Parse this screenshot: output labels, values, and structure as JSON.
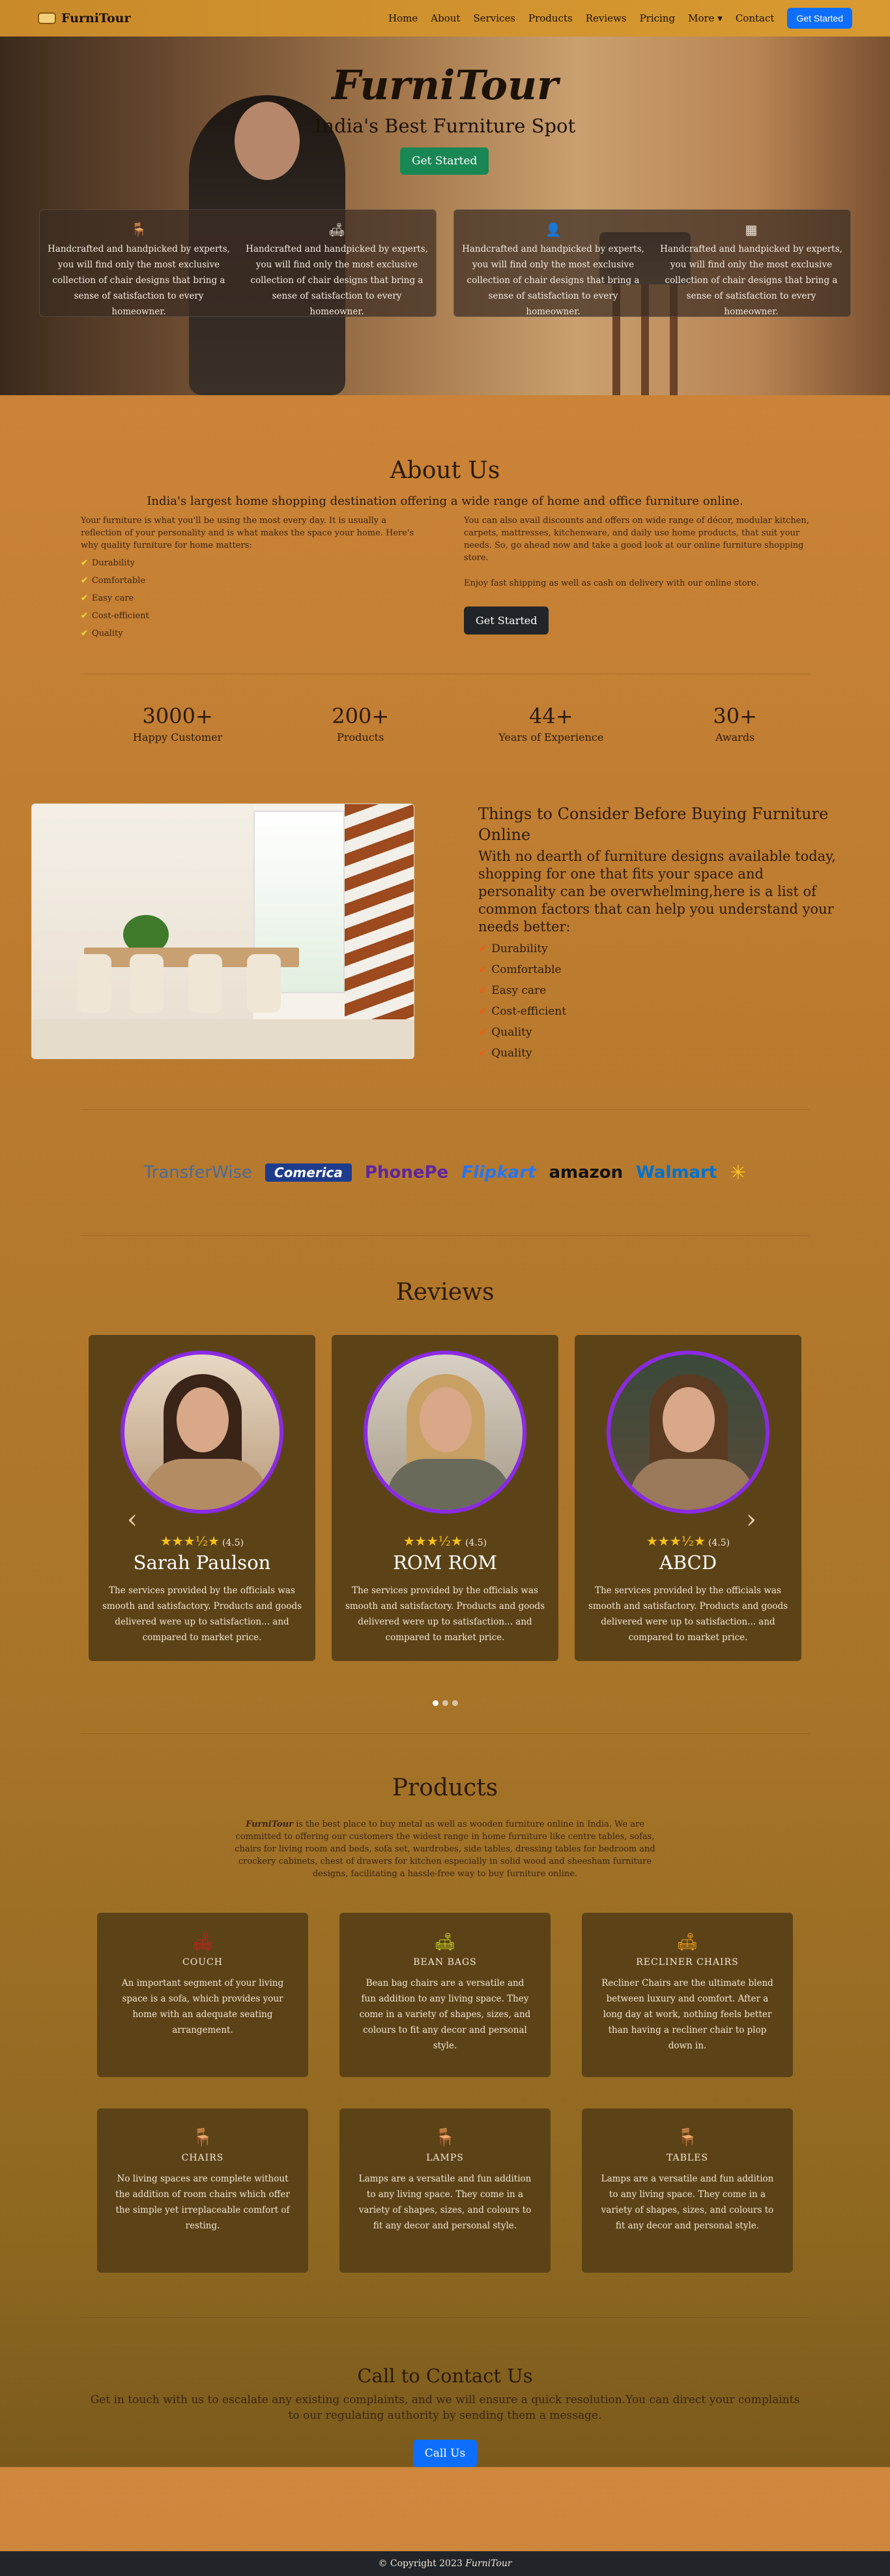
{
  "nav": {
    "brand": "FurniTour",
    "items": [
      "Home",
      "About",
      "Services",
      "Products",
      "Reviews",
      "Pricing",
      "More ▾",
      "Contact"
    ],
    "cta": "Get Started"
  },
  "hero": {
    "title": "FurniTour",
    "subtitle": "India's Best Furniture Spot",
    "cta": "Get Started",
    "features": [
      {
        "icon": "chair-icon",
        "text": "Handcrafted and handpicked by experts, you will find only the most exclusive collection of chair designs that bring a sense of satisfaction to every homeowner."
      },
      {
        "icon": "sofa-icon",
        "text": "Handcrafted and handpicked by experts, you will find only the most exclusive collection of chair designs that bring a sense of satisfaction to every homeowner."
      },
      {
        "icon": "support-icon",
        "text": "Handcrafted and handpicked by experts, you will find only the most exclusive collection of chair designs that bring a sense of satisfaction to every homeowner."
      },
      {
        "icon": "table-icon",
        "text": "Handcrafted and handpicked by experts, you will find only the most exclusive collection of chair designs that bring a sense of satisfaction to every homeowner."
      }
    ]
  },
  "about": {
    "title": "About Us",
    "subtitle": "India's largest home shopping destination offering a wide range of home and office furniture online.",
    "left_text": "Your furniture is what you'll be using the most every day. It is usually a reflection of your personality and is what makes the space your home. Here's why quality furniture for home matters:",
    "list": [
      "Durability",
      "Comfortable",
      "Easy care",
      "Cost-efficient",
      "Quality"
    ],
    "right_text": "You can also avail discounts and offers on wide range of décor, modular kitchen, carpets, mattresses, kitchenware, and daily use home products, that suit your needs. So, go ahead now and take a good look at our online furniture shopping store.",
    "right_text2": "Enjoy fast shipping as well as cash on delivery with our online store.",
    "cta": "Get Started"
  },
  "stats": [
    {
      "n": "3000+",
      "l": "Happy Customer"
    },
    {
      "n": "200+",
      "l": "Products"
    },
    {
      "n": "44+",
      "l": "Years of Experience"
    },
    {
      "n": "30+",
      "l": "Awards"
    }
  ],
  "things": {
    "title": "Things to Consider Before Buying Furniture Online",
    "text": "With no dearth of furniture designs available today, shopping for one that fits your space and personality can be overwhelming,here is a list of common factors that can help you understand your needs better:",
    "list": [
      "Durability",
      "Comfortable",
      "Easy care",
      "Cost-efficient",
      "Quality",
      "Quality"
    ]
  },
  "logos": [
    {
      "name": "TransferWise",
      "color": "#4a6a9a"
    },
    {
      "name": "Comerica",
      "color": "#1e3c8c"
    },
    {
      "name": "PhonePe",
      "color": "#5f259f"
    },
    {
      "name": "Flipkart",
      "color": "#2874f0"
    },
    {
      "name": "amazon",
      "color": "#111111"
    },
    {
      "name": "Walmart",
      "color": "#0071ce"
    }
  ],
  "reviews": {
    "title": "Reviews",
    "items": [
      {
        "stars": "★★★½★",
        "rate": "(4.5)",
        "name": "Sarah Paulson",
        "text": "The services provided by the officials was smooth and satisfactory. Products and goods delivered were up to satisfaction... and compared to market price."
      },
      {
        "stars": "★★★½★",
        "rate": "(4.5)",
        "name": "ROM ROM",
        "text": "The services provided by the officials was smooth and satisfactory. Products and goods delivered were up to satisfaction... and compared to market price."
      },
      {
        "stars": "★★★½★",
        "rate": "(4.5)",
        "name": "ABCD",
        "text": "The services provided by the officials was smooth and satisfactory. Products and goods delivered were up to satisfaction... and compared to market price."
      }
    ]
  },
  "products": {
    "title": "Products",
    "brand": "FurniTour",
    "intro": " is the best place to buy metal as well as wooden furniture online in India. We are committed to offering our customers the widest range in home furniture like centre tables, sofas, chairs for living room and beds, sofa set, wardrobes, side tables, dressing tables for bedroom and crockery cabinets, chest of drawers for kitchen especially in solid wood and sheesham furniture designs, facilitating a hassle-free way to buy furniture online.",
    "items": [
      {
        "title": "COUCH",
        "icon": "couch-icon",
        "color": "#c81e1e",
        "text": "An important segment of your living space is a sofa, which provides your home with an adequate seating arrangement."
      },
      {
        "title": "BEAN BAGS",
        "icon": "beanbag-icon",
        "color": "#c7d21e",
        "text": "Bean bag chairs are a versatile and fun addition to any living space. They come in a variety of shapes, sizes, and colours to fit any decor and personal style."
      },
      {
        "title": "RECLINER CHAIRS",
        "icon": "recliner-icon",
        "color": "#f0a21e",
        "text": "Recliner Chairs are the ultimate blend between luxury and comfort. After a long day at work, nothing feels better than having a recliner chair to plop down in."
      },
      {
        "title": "CHAIRS",
        "icon": "chair-icon",
        "color": "#2ec85a",
        "text": "No living spaces are complete without the addition of room chairs which offer the simple yet irreplaceable comfort of resting."
      },
      {
        "title": "LAMPS",
        "icon": "lamp-icon",
        "color": "#2ec89a",
        "text": "Lamps are a versatile and fun addition to any living space. They come in a variety of shapes, sizes, and colours to fit any decor and personal style."
      },
      {
        "title": "TABLES",
        "icon": "table-icon",
        "color": "#a83ecb",
        "text": "Lamps are a versatile and fun addition to any living space. They come in a variety of shapes, sizes, and colours to fit any decor and personal style."
      }
    ]
  },
  "contact": {
    "title": "Call to Contact Us",
    "text": "Get in touch with us to escalate any existing complaints, and we will ensure a quick resolution.You can direct your complaints to our regulating authority by sending them a message.",
    "cta": "Call Us"
  },
  "footer": {
    "text": "© Copyright 2023 ",
    "brand": "FurniTour"
  }
}
